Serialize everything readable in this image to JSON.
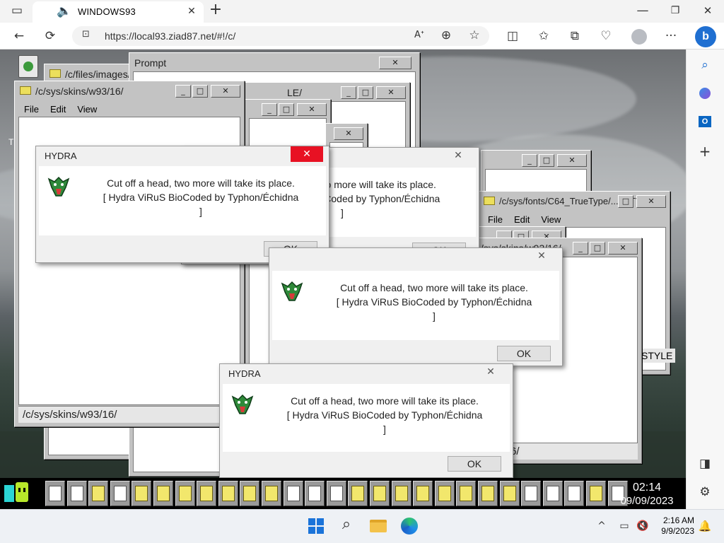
{
  "browser": {
    "tab_title": "WINDOWS93",
    "url": "https://local93.ziad87.net/#!/c/",
    "new_tab": "+",
    "window_controls": {
      "minimize": "—",
      "maximize": "❐",
      "close": "✕"
    },
    "nav": {
      "back": "←",
      "refresh": "⟳",
      "lock": "🔒"
    },
    "toolbar_icons": [
      "read-aloud-icon",
      "zoom-icon",
      "favorite-star-icon",
      "split-screen-icon",
      "favorites-icon",
      "collections-icon",
      "health-icon",
      "profile-icon",
      "more-icon",
      "bing-copilot-icon"
    ],
    "more": "···",
    "sidebar_icons": [
      "search-icon",
      "copilot-icon",
      "outlook-icon",
      "add-icon",
      "sidebar-toggle-icon",
      "settings-icon"
    ],
    "sidebar_add": "+"
  },
  "desktop": {
    "recycle_bin_label": "Trash",
    "partial_letter": "T",
    "windows": [
      {
        "title": "/c/files/images/icons/"
      },
      {
        "title": "/c/sys/skins/w93/16/",
        "menu": [
          "File",
          "Edit",
          "View"
        ],
        "status": "/c/sys/skins/w93/16/"
      },
      {
        "title": "Prompt"
      },
      {
        "title": "LE/"
      },
      {
        "title": "/c/sys/fonts/C64_TrueType/..._STYLE/",
        "menu": [
          "File",
          "Edit",
          "View"
        ]
      },
      {
        "title": "/sys/skins/w93/16/"
      },
      {
        "fragment_status": "w93/16/",
        "fragment_style": "STYLE"
      }
    ],
    "dialogs": [
      {
        "title": "HYDRA",
        "line1": "Cut off a head, two more will take its place.",
        "line2": "[ Hydra ViRuS BioCoded by Typhon/Échidna",
        "line3": "]",
        "ok": "OK",
        "close": "✕"
      },
      {
        "title": "",
        "line1": "Cut off a head, two more will take its place.",
        "line2": "[ Hydra ViRuS BioCoded by Typhon/Échidna",
        "line3": "]",
        "ok": "OK",
        "close": "✕"
      },
      {
        "title": "",
        "line1": "Cut off a head, two more will take its place.",
        "line2": "[ Hydra ViRuS BioCoded by Typhon/Échidna",
        "line3": "]",
        "ok": "OK",
        "close": "✕"
      },
      {
        "title": "HYDRA",
        "line1": "Cut off a head, two more will take its place.",
        "line2": "[ Hydra ViRuS BioCoded by Typhon/Échidna",
        "line3": "]",
        "ok": "OK",
        "close": "✕"
      }
    ],
    "dock": {
      "time": "02:14",
      "date": "09/09/2023",
      "item_count": 27
    }
  },
  "taskbar": {
    "time": "2:16 AM",
    "date": "9/9/2023",
    "icons": [
      "windows-start-icon",
      "search-icon",
      "file-explorer-icon",
      "edge-icon"
    ],
    "tray_icons": [
      "chevron-up-icon",
      "network-icon",
      "volume-muted-icon",
      "notification-bell-icon"
    ]
  },
  "colors": {
    "close_red": "#e81123",
    "win93_gray": "#c3c3c3",
    "folder_yellow": "#ecdf5c"
  }
}
